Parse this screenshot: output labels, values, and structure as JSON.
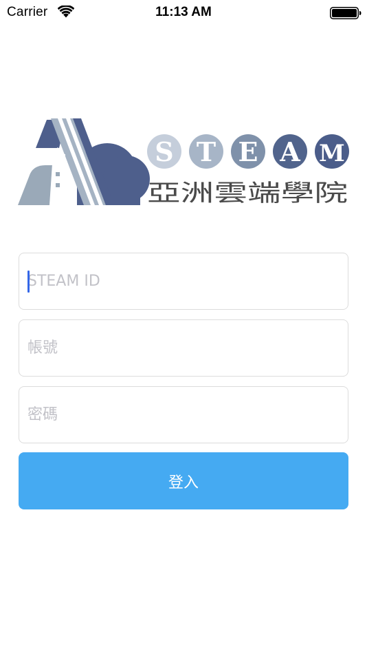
{
  "status_bar": {
    "carrier": "Carrier",
    "time": "11:13 AM",
    "wifi_icon": "wifi-icon",
    "battery_icon": "battery-icon"
  },
  "logo": {
    "letters": [
      "S",
      "T",
      "E",
      "A",
      "M"
    ],
    "letter_colors": [
      "#c5cedb",
      "#a7b5c7",
      "#7f91aa",
      "#51648c",
      "#4b5d8a"
    ],
    "subtitle": "亞洲雲端學院",
    "colors": {
      "navy": "#4e5f8c",
      "slate": "#9aa9b8",
      "text": "#4a4a4a"
    }
  },
  "form": {
    "steam_id_placeholder": "STEAM ID",
    "account_placeholder": "帳號",
    "password_placeholder": "密碼",
    "login_label": "登入"
  },
  "colors": {
    "accent": "#45aaf2",
    "caret": "#3467e8",
    "field_border": "#dcdcdc",
    "placeholder": "#c2c2c8"
  }
}
